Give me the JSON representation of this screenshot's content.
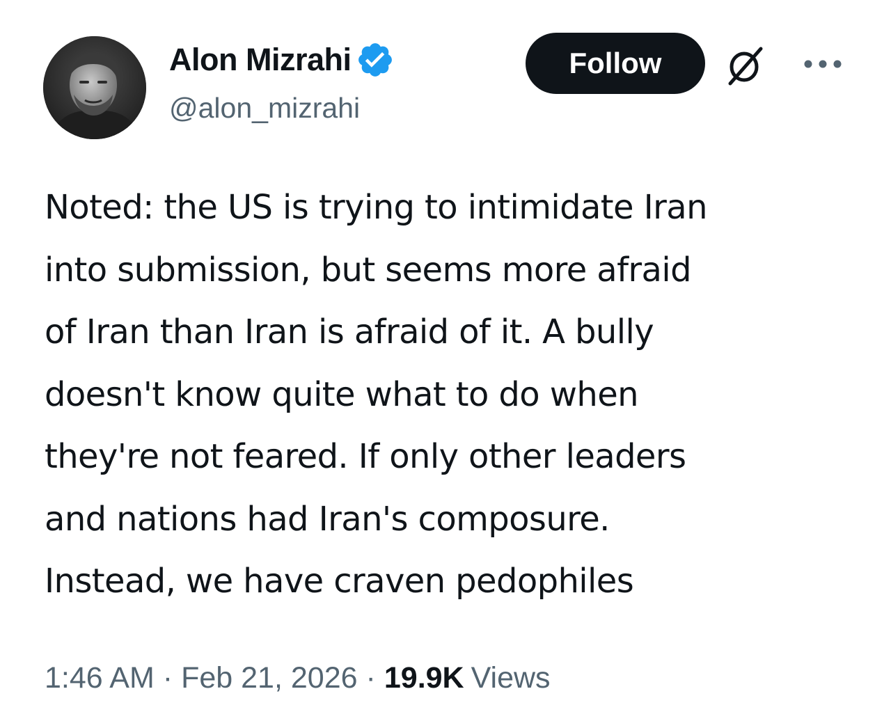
{
  "author": {
    "display_name": "Alon Mizrahi",
    "handle": "@alon_mizrahi",
    "verified": true
  },
  "actions": {
    "follow_label": "Follow"
  },
  "icons": {
    "verified": "verified-badge-icon",
    "grok": "grok-icon",
    "more": "more-icon"
  },
  "tweet": {
    "text": "Noted: the US is trying to intimidate Iran\ninto submission, but seems more afraid\nof Iran than Iran is afraid of it. A bully\ndoesn't know quite what to do when\nthey're not feared. If only other leaders\nand nations had Iran's composure.\nInstead, we have craven pedophiles",
    "time": "1:46 AM",
    "separator": "·",
    "date": "Feb 21, 2026",
    "views_count": "19.9K",
    "views_label": "Views"
  },
  "colors": {
    "primary_text": "#0f1419",
    "secondary_text": "#536471",
    "verified_blue": "#1d9bf0",
    "follow_bg": "#0f1419"
  }
}
